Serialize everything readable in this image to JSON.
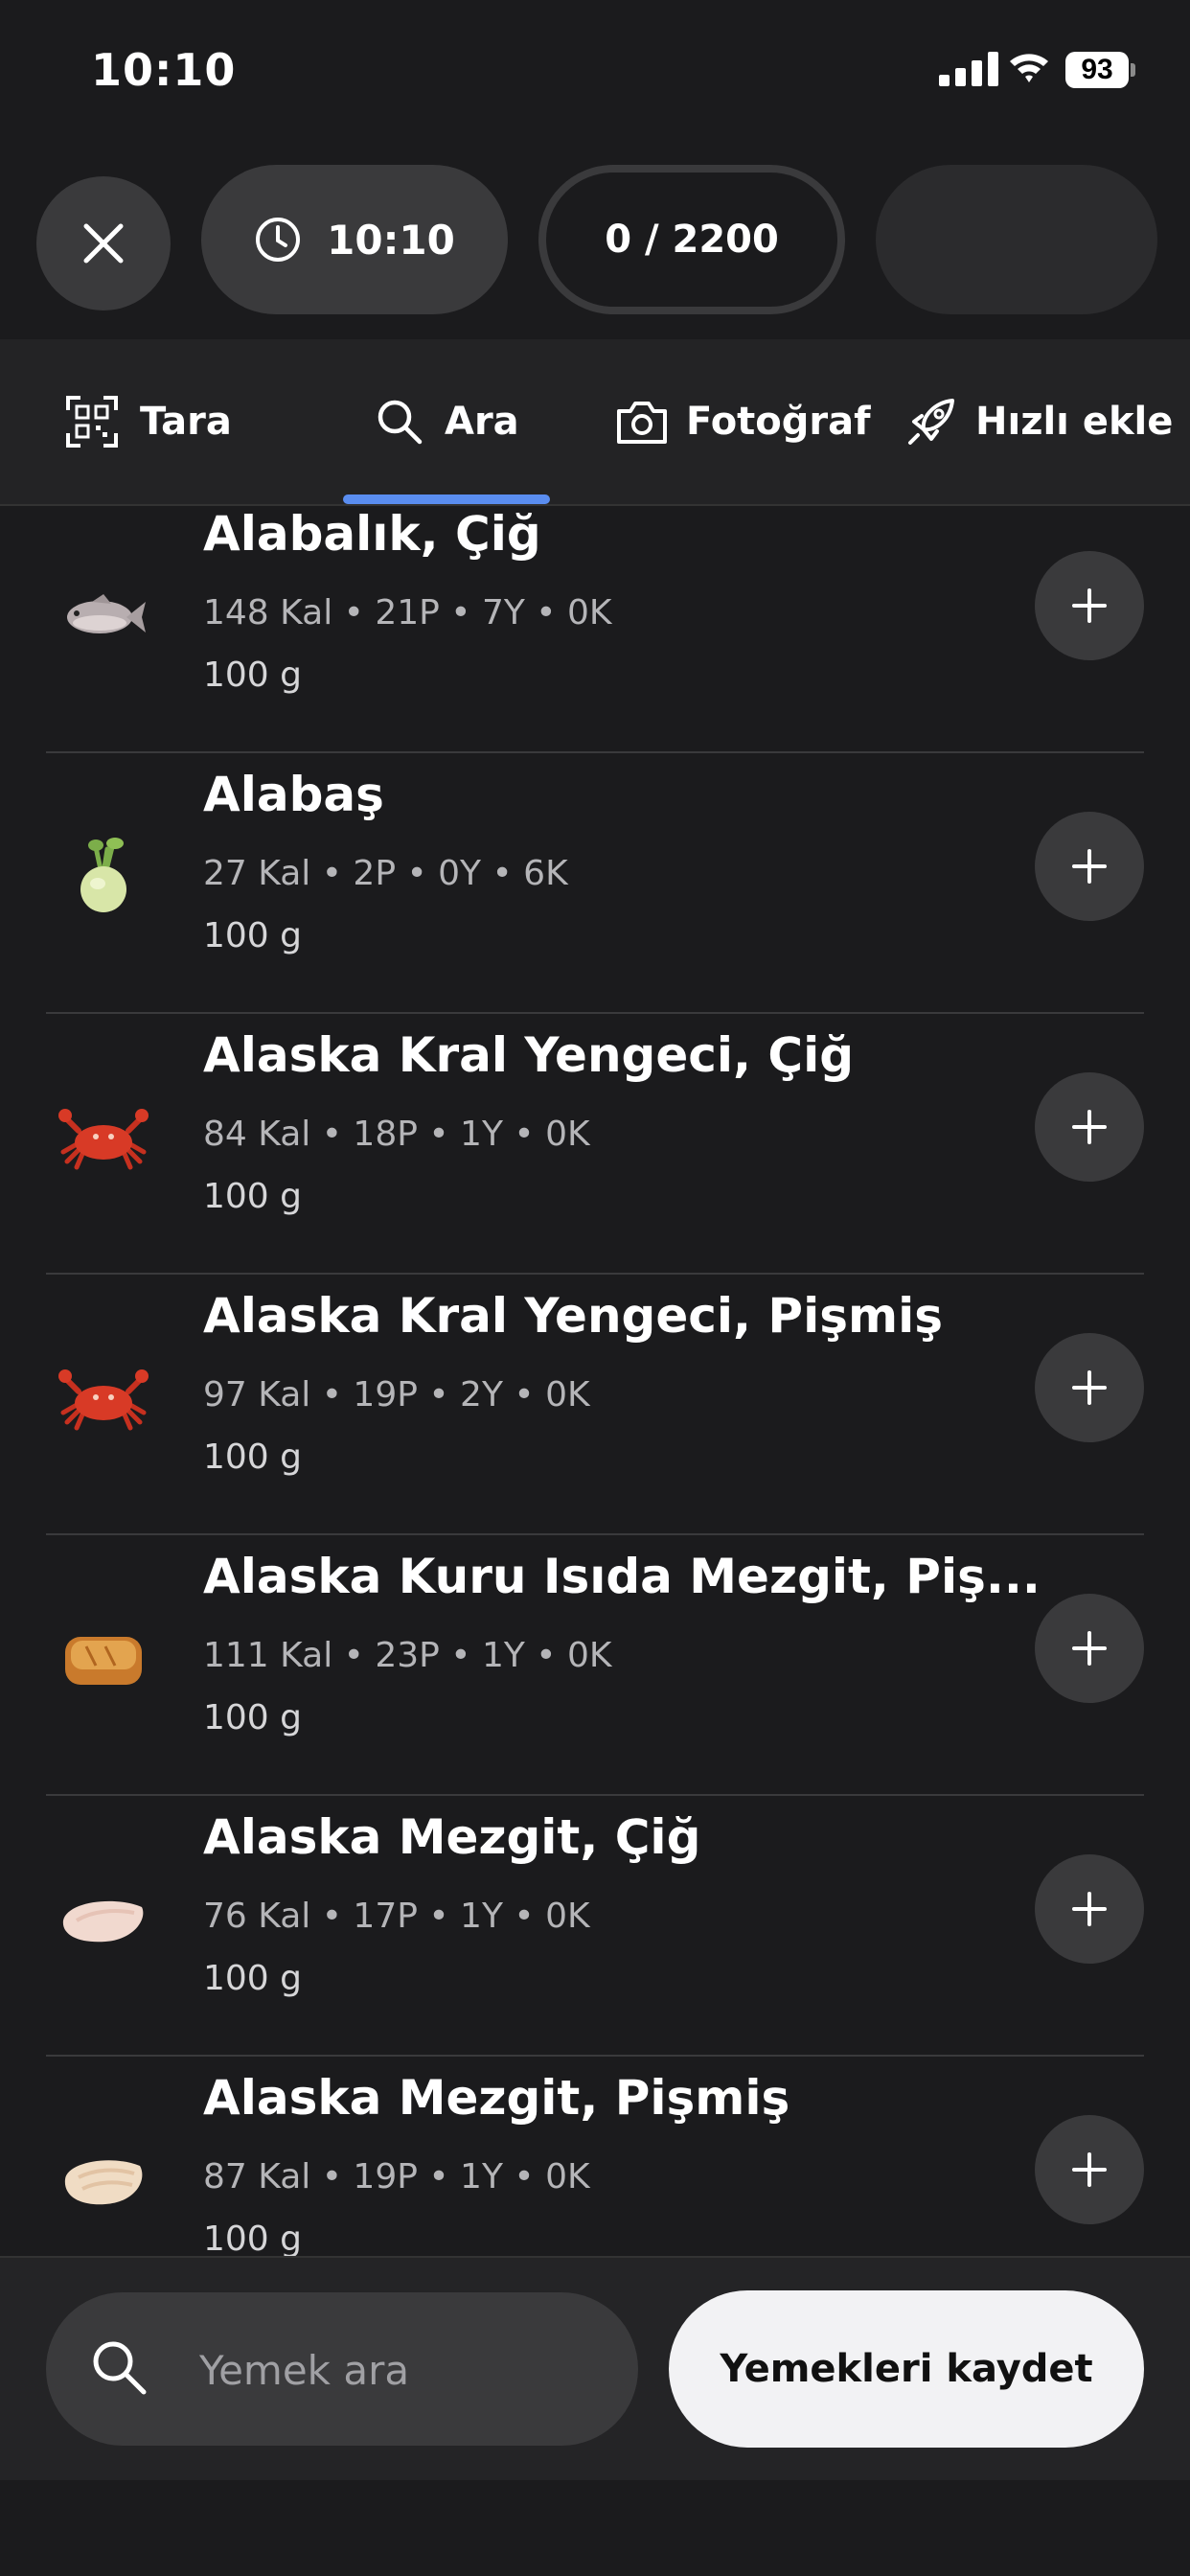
{
  "status_bar": {
    "time": "10:10",
    "battery": "93"
  },
  "header": {
    "close_icon": "close-icon",
    "time_label": "10:10",
    "calorie_counter": "0 / 2200"
  },
  "tabs": [
    {
      "label": "Tara",
      "icon": "qr-scan-icon"
    },
    {
      "label": "Ara",
      "icon": "search-icon",
      "active": true
    },
    {
      "label": "Fotoğraf",
      "icon": "camera-icon"
    },
    {
      "label": "Hızlı ekle",
      "icon": "rocket-icon"
    }
  ],
  "foods": [
    {
      "name": "Alabalık, Çiğ",
      "macros": "148 Kal • 21P • 7Y • 0K",
      "portion": "100 g",
      "icon": "fish-icon"
    },
    {
      "name": "Alabaş",
      "macros": "27 Kal • 2P • 0Y • 6K",
      "portion": "100 g",
      "icon": "kohlrabi-icon"
    },
    {
      "name": "Alaska Kral Yengeci, Çiğ",
      "macros": "84 Kal • 18P • 1Y • 0K",
      "portion": "100 g",
      "icon": "crab-icon"
    },
    {
      "name": "Alaska Kral Yengeci, Pişmiş",
      "macros": "97 Kal • 19P • 2Y • 0K",
      "portion": "100 g",
      "icon": "crab-icon"
    },
    {
      "name": "Alaska Kuru Isıda Mezgit, Piş...",
      "macros": "111 Kal • 23P • 1Y • 0K",
      "portion": "100 g",
      "icon": "baked-fish-icon"
    },
    {
      "name": "Alaska Mezgit, Çiğ",
      "macros": "76 Kal • 17P • 1Y • 0K",
      "portion": "100 g",
      "icon": "fish-fillet-icon"
    },
    {
      "name": "Alaska Mezgit, Pişmiş",
      "macros": "87 Kal • 19P • 1Y • 0K",
      "portion": "100 g",
      "icon": "fish-fillet-icon"
    }
  ],
  "bottom": {
    "search_placeholder": "Yemek ara",
    "save_label": "Yemekleri kaydet"
  }
}
